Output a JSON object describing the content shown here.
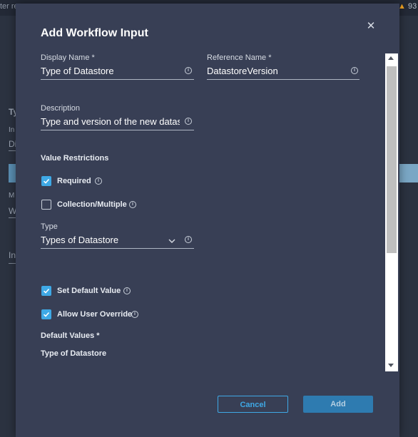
{
  "background": {
    "topbar_fragment_left": "ter re",
    "topbar_fragment_mid": "...",
    "topbar_count": "93",
    "fragments": [
      "Ty",
      "In",
      "Di",
      "M",
      "W",
      "In"
    ]
  },
  "dialog": {
    "title": "Add Workflow Input",
    "close_icon": "close-icon",
    "display_name": {
      "label": "Display Name *",
      "value": "Type of Datastore"
    },
    "reference_name": {
      "label": "Reference Name *",
      "value": "DatastoreVersion"
    },
    "description": {
      "label": "Description",
      "value": "Type and version of the new datast"
    },
    "value_restrictions": "Value Restrictions",
    "required": {
      "label": "Required",
      "checked": true
    },
    "collection": {
      "label": "Collection/Multiple",
      "checked": false
    },
    "type": {
      "label": "Type",
      "value": "Types of Datastore"
    },
    "set_default": {
      "label": "Set Default Value",
      "checked": true
    },
    "allow_override": {
      "label": "Allow User Override",
      "checked": true
    },
    "default_values": "Default Values *",
    "default_type_label": "Type of Datastore",
    "buttons": {
      "cancel": "Cancel",
      "add": "Add"
    }
  },
  "colors": {
    "modal_bg": "#383f55",
    "accent": "#3fa9e6",
    "primary_button": "#2e7bb0",
    "warning": "#f5a623"
  }
}
